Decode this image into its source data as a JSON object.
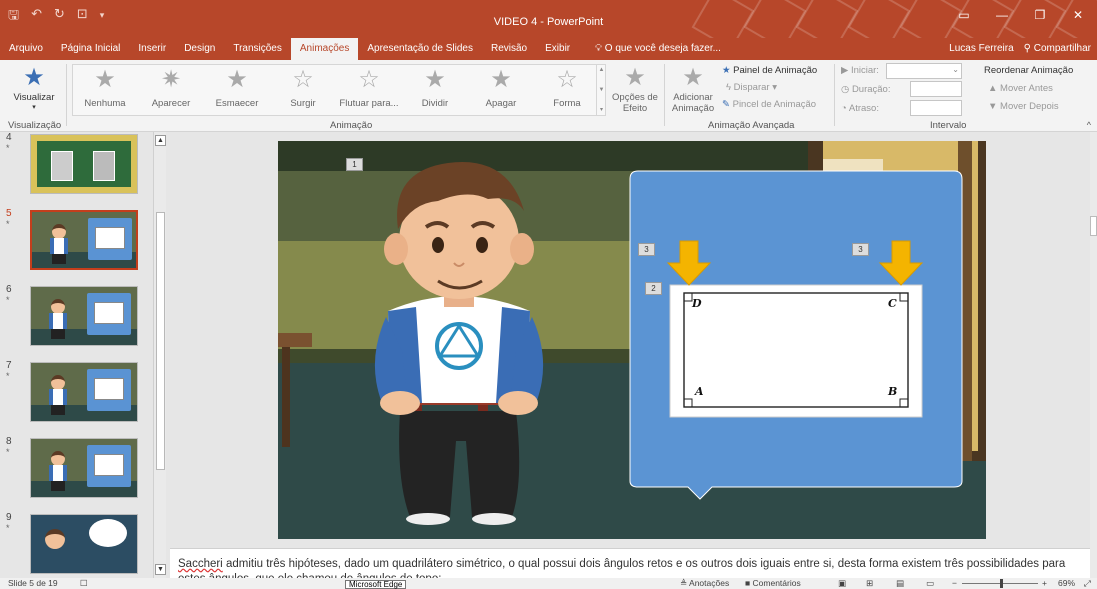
{
  "window": {
    "title": "VIDEO 4 - PowerPoint"
  },
  "tabs": [
    {
      "label": "Arquivo",
      "active": false
    },
    {
      "label": "Página Inicial",
      "active": false
    },
    {
      "label": "Inserir",
      "active": false
    },
    {
      "label": "Design",
      "active": false
    },
    {
      "label": "Transições",
      "active": false
    },
    {
      "label": "Animações",
      "active": true
    },
    {
      "label": "Apresentação de Slides",
      "active": false
    },
    {
      "label": "Revisão",
      "active": false
    },
    {
      "label": "Exibir",
      "active": false
    }
  ],
  "tell_me": "O que você deseja fazer...",
  "user": {
    "name": "Lucas Ferreira",
    "share": "Compartilhar"
  },
  "ribbon": {
    "preview": {
      "label": "Visualizar",
      "group": "Visualização"
    },
    "animations": [
      {
        "label": "Nenhuma",
        "icon": "star-outline-icon"
      },
      {
        "label": "Aparecer",
        "icon": "star-burst-icon"
      },
      {
        "label": "Esmaecer",
        "icon": "star-fade-icon"
      },
      {
        "label": "Surgir",
        "icon": "star-fly-in-icon"
      },
      {
        "label": "Flutuar para...",
        "icon": "star-float-icon"
      },
      {
        "label": "Dividir",
        "icon": "star-split-icon"
      },
      {
        "label": "Apagar",
        "icon": "star-wipe-icon"
      },
      {
        "label": "Forma",
        "icon": "star-shape-icon"
      }
    ],
    "animation_group": "Animação",
    "effect_options": "Opções de Efeito",
    "add_animation": "Adicionar Animação",
    "animation_pane": "Painel de Animação",
    "trigger": "Disparar",
    "painter": "Pincel de Animação",
    "advanced_group": "Animação Avançada",
    "start": "Iniciar:",
    "duration": "Duração:",
    "delay": "Atraso:",
    "reorder": "Reordenar Animação",
    "move_earlier": "Mover Antes",
    "move_later": "Mover Depois",
    "timing_group": "Intervalo"
  },
  "thumbnails": [
    {
      "number": "4",
      "star": "*",
      "selected": false
    },
    {
      "number": "5",
      "star": "*",
      "selected": true
    },
    {
      "number": "6",
      "star": "*",
      "selected": false
    },
    {
      "number": "7",
      "star": "*",
      "selected": false
    },
    {
      "number": "8",
      "star": "*",
      "selected": false
    },
    {
      "number": "9",
      "star": "*",
      "selected": false
    }
  ],
  "slide": {
    "tags": [
      {
        "text": "1"
      },
      {
        "text": "3"
      },
      {
        "text": "3"
      },
      {
        "text": "2"
      }
    ],
    "corners": {
      "d": "D",
      "c": "C",
      "a": "A",
      "b": "B"
    }
  },
  "notes": {
    "word1": "Saccheri",
    "text": " admitiu três hipóteses, dado um quadrilátero simétrico, o qual possui dois ângulos retos e os outros dois iguais entre si, desta forma existem três possibilidades para estes ângulos, que ele chamou de ângulos de topo:"
  },
  "status": {
    "slide": "Slide 5 de 19",
    "notes": "Anotações",
    "comments": "Comentários",
    "zoom": "69%"
  },
  "taskbar_tooltip": "Microsoft Edge"
}
